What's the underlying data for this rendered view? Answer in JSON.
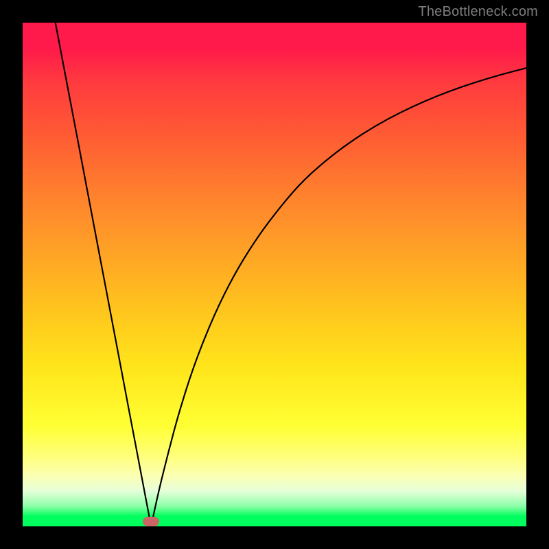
{
  "watermark": "TheBottleneck.com",
  "chart_data": {
    "type": "line",
    "title": "",
    "xlabel": "",
    "ylabel": "",
    "xlim": [
      0,
      100
    ],
    "ylim": [
      0,
      100
    ],
    "grid": false,
    "legend": false,
    "series": [
      {
        "name": "left-branch",
        "x": [
          6.5,
          8.0,
          10.0,
          12.0,
          14.0,
          16.0,
          18.0,
          20.0,
          22.0,
          24.0,
          25.5
        ],
        "values": [
          100.0,
          92.1,
          81.6,
          71.1,
          60.5,
          50.0,
          39.5,
          28.9,
          18.4,
          7.9,
          0.0
        ]
      },
      {
        "name": "right-branch",
        "x": [
          25.5,
          27.0,
          29.0,
          31.0,
          34.0,
          38.0,
          42.0,
          46.0,
          50.0,
          55.0,
          60.0,
          65.0,
          70.0,
          75.0,
          80.0,
          85.0,
          90.0,
          95.0,
          100.0
        ],
        "values": [
          0.0,
          7.0,
          15.0,
          22.5,
          32.0,
          42.0,
          50.0,
          56.5,
          62.0,
          68.0,
          72.5,
          76.3,
          79.5,
          82.2,
          84.5,
          86.5,
          88.2,
          89.7,
          91.0
        ]
      }
    ],
    "annotations": [
      {
        "name": "optimum-marker",
        "x": 25.5,
        "y": 1.0,
        "shape": "pill"
      }
    ],
    "background": "red-yellow-green vertical gradient"
  }
}
